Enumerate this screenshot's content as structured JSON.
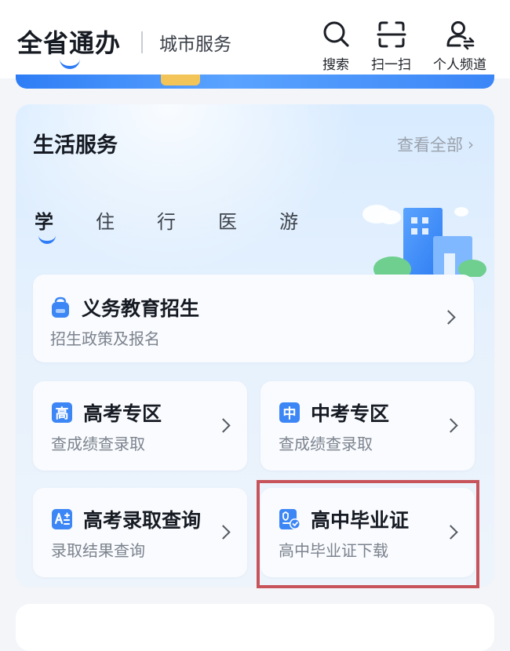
{
  "header": {
    "title": "全省通办",
    "city_tab": "城市服务",
    "actions": [
      {
        "label": "搜索",
        "icon": "search-icon"
      },
      {
        "label": "扫一扫",
        "icon": "scan-icon"
      },
      {
        "label": "个人频道",
        "icon": "person-icon"
      }
    ],
    "accent_color": "#2e7cf6"
  },
  "life_services": {
    "title": "生活服务",
    "view_all": "查看全部",
    "tabs": [
      {
        "label": "学",
        "active": true
      },
      {
        "label": "住",
        "active": false
      },
      {
        "label": "行",
        "active": false
      },
      {
        "label": "医",
        "active": false
      },
      {
        "label": "游",
        "active": false
      }
    ],
    "tiles": [
      {
        "title": "义务教育招生",
        "subtitle": "招生政策及报名",
        "icon": "school-bag-icon"
      },
      {
        "title": "高考专区",
        "subtitle": "查成绩查录取",
        "icon": "gaokao-badge-icon",
        "badge": "高"
      },
      {
        "title": "中考专区",
        "subtitle": "查成绩查录取",
        "icon": "zhongkao-badge-icon",
        "badge": "中"
      },
      {
        "title": "高考录取查询",
        "subtitle": "录取结果查询",
        "icon": "query-doc-icon"
      },
      {
        "title": "高中毕业证",
        "subtitle": "高中毕业证下载",
        "icon": "certificate-icon",
        "highlighted": true
      }
    ],
    "highlight_color": "#c7545b"
  }
}
